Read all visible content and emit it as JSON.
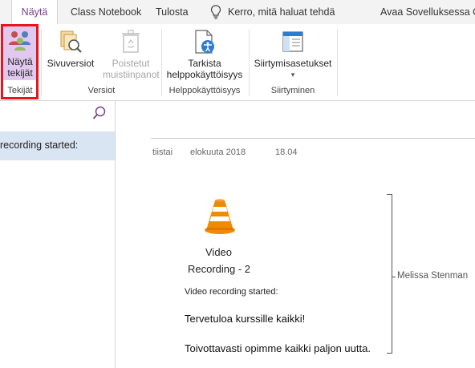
{
  "tabs": {
    "view": "Näytä",
    "class_notebook": "Class Notebook",
    "print": "Tulosta",
    "tell_me": "Kerro, mitä haluat tehdä",
    "open_in": "Avaa Sovelluksessa On"
  },
  "ribbon": {
    "show_authors": {
      "line1": "Näytä",
      "line2": "tekijät"
    },
    "group_authors": "Tekijät",
    "page_versions": "Sivuversiot",
    "deleted_notes": {
      "line1": "Poistetut",
      "line2": "muistiinpanot"
    },
    "group_versions": "Versiot",
    "check_accessibility": {
      "line1": "Tarkista",
      "line2": "helppokäyttöisyys"
    },
    "group_accessibility": "Helppokäyttöisyys",
    "navigation_settings": "Siirtymisasetukset",
    "navigation_dropdown": "▾",
    "group_navigation": "Siirtyminen"
  },
  "sidebar": {
    "page_item": "recording started:"
  },
  "note": {
    "date": {
      "weekday": "tiistai",
      "date": "elokuuta 2018",
      "time": "18.04"
    },
    "video_title_line1": "Video",
    "video_title_line2": "Recording - 2",
    "recording_started": "Video recording started:",
    "line1": "Tervetuloa kurssille kaikki!",
    "line2": "Toivottavasti opimme kaikki paljon uutta.",
    "author": "Melissa Stenman"
  },
  "colors": {
    "accent": "#7b3f8f",
    "annotation_red": "#e8141e",
    "selected_page": "#d9e5f2",
    "vlc_orange": "#f08a00"
  }
}
